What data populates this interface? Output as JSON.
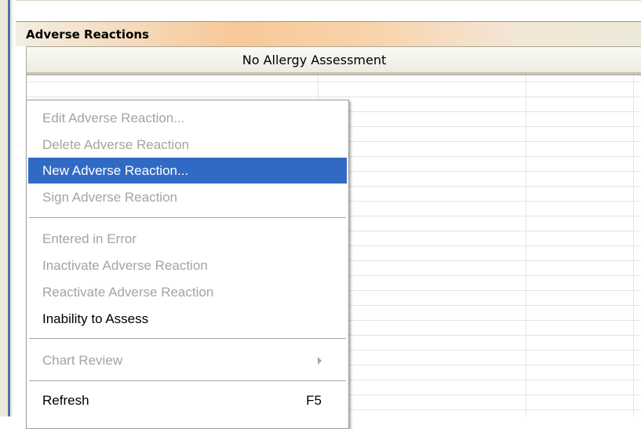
{
  "panel": {
    "title": "Adverse Reactions",
    "column_header": "No Allergy Assessment"
  },
  "context_menu": {
    "items": [
      {
        "label": "Edit Adverse Reaction...",
        "enabled": false
      },
      {
        "label": "Delete Adverse Reaction",
        "enabled": false
      },
      {
        "label": "New Adverse Reaction...",
        "enabled": true,
        "highlighted": true
      },
      {
        "label": "Sign Adverse Reaction",
        "enabled": false
      },
      {
        "label": "Entered in Error",
        "enabled": false
      },
      {
        "label": "Inactivate Adverse Reaction",
        "enabled": false
      },
      {
        "label": "Reactivate Adverse Reaction",
        "enabled": false
      },
      {
        "label": "Inability to Assess",
        "enabled": true
      },
      {
        "label": "Chart Review",
        "enabled": false,
        "submenu": true
      },
      {
        "label": "Refresh",
        "enabled": true,
        "shortcut": "F5"
      }
    ]
  },
  "colors": {
    "highlight": "#316ac5",
    "disabled_text": "#a6a4a0",
    "title_gradient_accent": "#f8c898"
  }
}
